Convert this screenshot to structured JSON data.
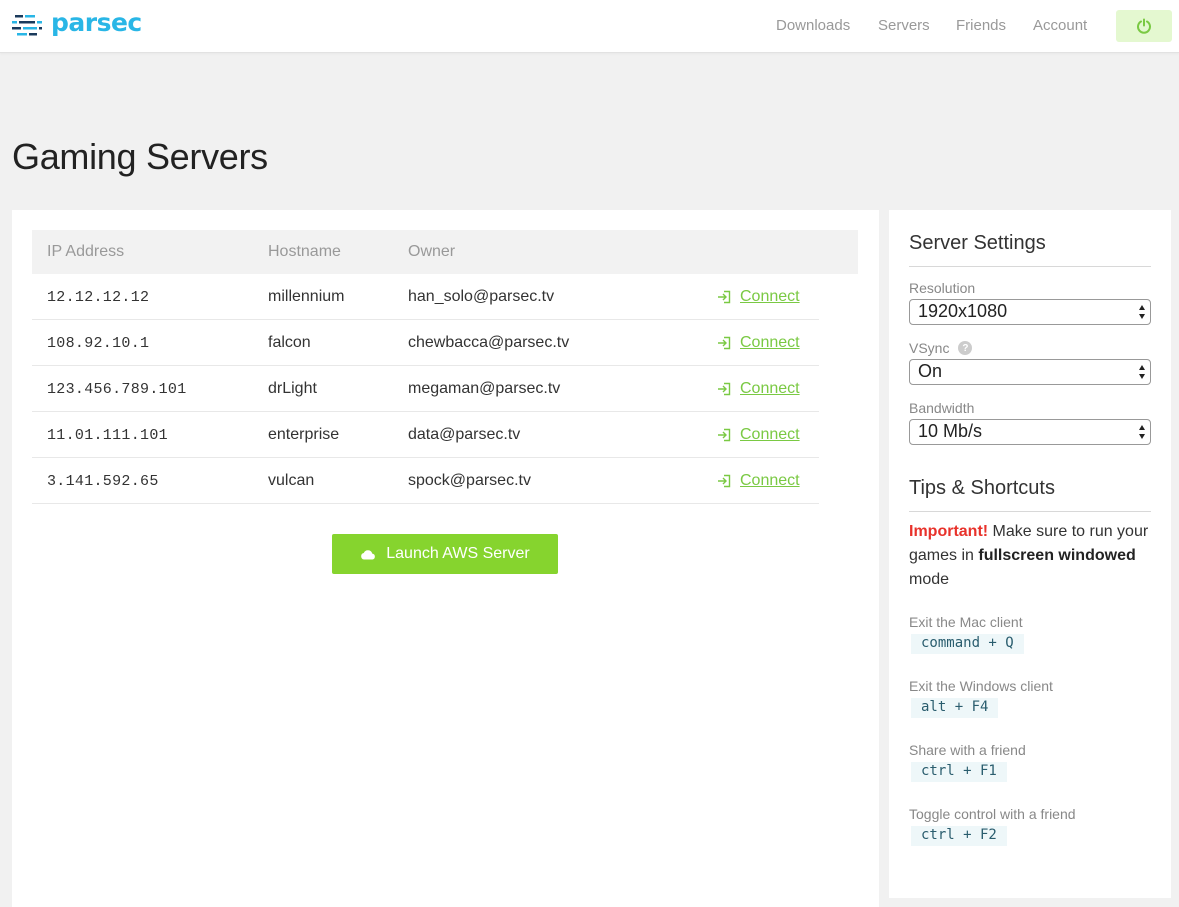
{
  "brand": {
    "name": "parsec"
  },
  "nav": {
    "items": [
      "Downloads",
      "Servers",
      "Friends",
      "Account"
    ]
  },
  "page": {
    "title": "Gaming Servers"
  },
  "servers": {
    "columns": [
      "IP Address",
      "Hostname",
      "Owner"
    ],
    "rows": [
      {
        "ip": "12.12.12.12",
        "host": "millennium",
        "owner": "han_solo@parsec.tv",
        "action": "Connect"
      },
      {
        "ip": "108.92.10.1",
        "host": "falcon",
        "owner": "chewbacca@parsec.tv",
        "action": "Connect"
      },
      {
        "ip": "123.456.789.101",
        "host": "drLight",
        "owner": "megaman@parsec.tv",
        "action": "Connect"
      },
      {
        "ip": "11.01.111.101",
        "host": "enterprise",
        "owner": "data@parsec.tv",
        "action": "Connect"
      },
      {
        "ip": "3.141.592.65",
        "host": "vulcan",
        "owner": "spock@parsec.tv",
        "action": "Connect"
      }
    ],
    "launch_label": "Launch AWS Server"
  },
  "settings": {
    "title": "Server Settings",
    "resolution": {
      "label": "Resolution",
      "value": "1920x1080"
    },
    "vsync": {
      "label": "VSync",
      "value": "On",
      "help": "?"
    },
    "bandwidth": {
      "label": "Bandwidth",
      "value": "10 Mb/s"
    }
  },
  "tips": {
    "title": "Tips & Shortcuts",
    "important_label": "Important!",
    "important_text_1": " Make sure to run your games in ",
    "important_bold": "fullscreen windowed",
    "important_text_2": " mode",
    "shortcuts": [
      {
        "label": "Exit the Mac client",
        "keys": "command + Q"
      },
      {
        "label": "Exit the Windows client",
        "keys": "alt + F4"
      },
      {
        "label": "Share with a friend",
        "keys": "ctrl + F1"
      },
      {
        "label": "Toggle control with a friend",
        "keys": "ctrl + F2"
      }
    ]
  },
  "colors": {
    "brand": "#29b6e6",
    "accent_green": "#86d42e",
    "link_green": "#7ac943",
    "important_red": "#e8322b"
  }
}
